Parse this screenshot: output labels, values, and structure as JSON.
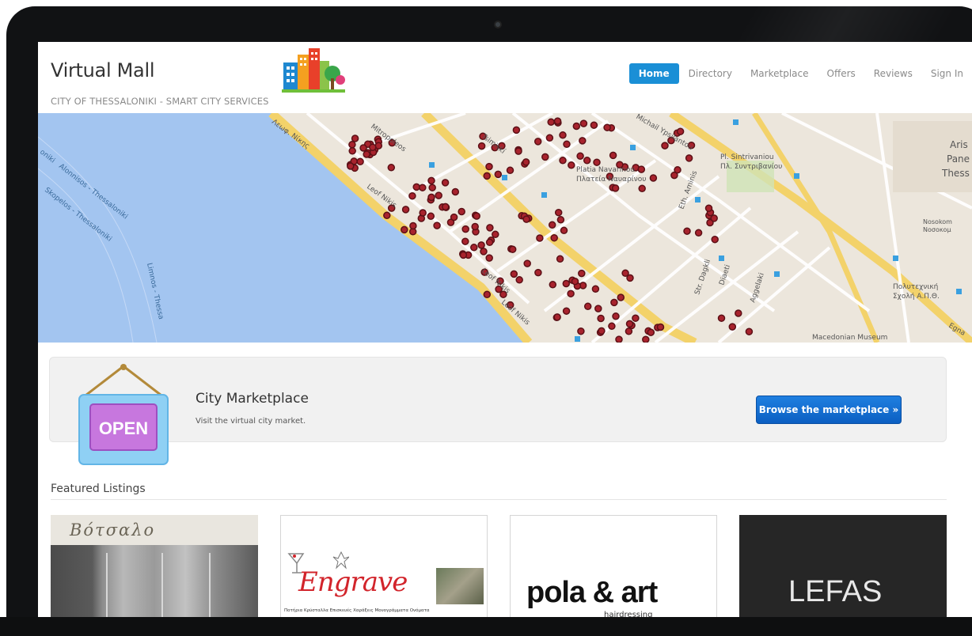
{
  "header": {
    "brand": "Virtual Mall",
    "tagline": "CITY OF THESSALONIKI - SMART CITY SERVICES"
  },
  "nav": {
    "items": [
      {
        "label": "Home",
        "active": true
      },
      {
        "label": "Directory",
        "active": false
      },
      {
        "label": "Marketplace",
        "active": false
      },
      {
        "label": "Offers",
        "active": false
      },
      {
        "label": "Reviews",
        "active": false
      },
      {
        "label": "Sign In",
        "active": false
      }
    ]
  },
  "map": {
    "labels": {
      "leof_nikis_1": "Λεωφ. Νίκης",
      "leof_nikis_2": "Leof Nikis",
      "leof_nikis_3": "Leof Nikis",
      "leof_nikis_4": "Leof Nikis",
      "mitropoleos": "Mitropoleos",
      "tsimiski": "Tsimiskí",
      "michail": "Michail Ypsilantou",
      "platia": "Platia Navarinou",
      "platia_gr": "Πλατεία Ναυαρίνου",
      "alonnisos": "Alonnisos - Thessaloniki",
      "skopelos": "Skopelos - Thessaloniki",
      "limnos": "Limnos - Thessa",
      "oniki": "oniki",
      "pl_syntrivaniou": "Pl. Sintrivaniou",
      "pl_syntrivaniou_gr": "Πλ. Συντριβανίου",
      "str_dagkli": "Str. Dagkli",
      "diaeti": "Diaeti",
      "aggelaki": "Aggelaki",
      "ethn_amynis": "Eth. Aminis",
      "politechniki": "Πολυτεχνική",
      "politechniki_2": "Σχολή Α.Π.Θ.",
      "macedonian_museum": "Macedonian Museum",
      "aris": "Aris",
      "pane": "Pane",
      "thess": "Thess",
      "egnatia": "Egna",
      "nosokomeio": "Nosokom",
      "nosokomeio_gr": "Νοσοκομ"
    },
    "colors": {
      "sea": "#a3c5f0",
      "land": "#ece6dc",
      "road_major": "#f3d26a",
      "marker": "#a8232d"
    }
  },
  "banner": {
    "sign_text": "OPEN",
    "title": "City Marketplace",
    "subtitle": "Visit the virtual city market.",
    "button": "Browse the marketplace »"
  },
  "featured": {
    "heading": "Featured Listings",
    "cards": [
      {
        "name": "Βότσαλο"
      },
      {
        "name": "Engrave",
        "sub": "Ποτήρια Κρύσταλλα Επισκευές Χαράξεις Μονογράμματα Ονόματα"
      },
      {
        "name": "pola & art",
        "sub": "hairdressing"
      },
      {
        "name": "LEFAS"
      }
    ]
  }
}
